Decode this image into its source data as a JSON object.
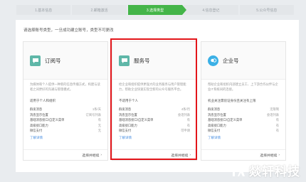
{
  "steps": [
    "1.基本信息",
    "2.邮箱激活",
    "3.选择类型",
    "4.信息登记",
    "5.公众号信息"
  ],
  "intro": "请选择账号类型，一旦成功建立账号，类型不可更改",
  "cards": [
    {
      "title": "订阅号",
      "icon": "chat-bubble-icon",
      "desc": "为媒体和个人提供一种新的信息传播方式，构建与读者之间更好的沟通与管理模式。",
      "fit": "适用于个人和组织",
      "rows": [
        [
          "群发消息",
          "1条/天"
        ],
        [
          "消息显示位置",
          "订阅号列表"
        ],
        [
          "基础消息接口/自定义菜单",
          "有"
        ],
        [
          "高级接口能力",
          "无"
        ],
        [
          "微信支付",
          "无"
        ]
      ],
      "more": "了解详情",
      "select": "选择并继续"
    },
    {
      "title": "服务号",
      "icon": "chat-bubble-icon",
      "desc": "给企业和组织提供更强大的业务服务与用户管理能力，帮助企业快速实现全新的公众号服务平台。",
      "fit": "不适用于个人",
      "rows": [
        [
          "群发消息",
          "4条/月"
        ],
        [
          "消息显示位置",
          "会话列表"
        ],
        [
          "基础消息接口/自定义菜单",
          "有"
        ],
        [
          "高级接口能力",
          "有"
        ],
        [
          "微信支付",
          "可申请"
        ]
      ],
      "more": "了解详情",
      "select": "选择并继续"
    },
    {
      "title": "企业号",
      "icon": "enterprise-icon",
      "desc": "帮助企业和组织内部建立员工、上下游合作伙伴与企业IT系统间的连接。",
      "fit": "机业关注需验证身份且关注有上限",
      "rows": [
        [
          "群发消息",
          "无限制"
        ],
        [
          "消息显示位置",
          "会话列表"
        ],
        [
          "基础消息接口/自定义菜单",
          "有"
        ],
        [
          "高级接口能力",
          "有"
        ],
        [
          "微信支付",
          "有"
        ]
      ],
      "more": "了解详情",
      "select": "选择并继续"
    }
  ],
  "watermark": "燚轩科技",
  "colors": {
    "active_step": "#44b549",
    "highlight": "#e3151a",
    "card_icon_green": "#5fb7a8",
    "card_icon_blue": "#3bb0e6"
  }
}
